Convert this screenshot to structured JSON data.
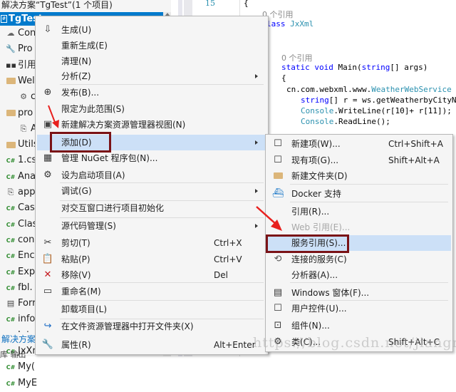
{
  "solution_explorer": {
    "title": "解决方案“TgTest”(1 个项目)",
    "root_project": "TgTest",
    "items": [
      {
        "icon": "cloud-icon",
        "label": "Con"
      },
      {
        "icon": "wrench-icon",
        "label": "Pro"
      },
      {
        "icon": "references-icon",
        "label": "引用"
      },
      {
        "icon": "folder-icon",
        "label": "Wel"
      },
      {
        "icon": "web-reference-icon",
        "label": "c"
      },
      {
        "icon": "folder-icon",
        "label": "pro"
      },
      {
        "icon": "config-file-icon",
        "label": "A"
      },
      {
        "icon": "folder-icon",
        "label": "Utils"
      },
      {
        "icon": "csharp-icon",
        "label": "1.cs"
      },
      {
        "icon": "csharp-icon",
        "label": "Ana"
      },
      {
        "icon": "config-file-icon",
        "label": "app"
      },
      {
        "icon": "csharp-icon",
        "label": "Cas"
      },
      {
        "icon": "csharp-icon",
        "label": "Clas"
      },
      {
        "icon": "csharp-icon",
        "label": "con"
      },
      {
        "icon": "csharp-icon",
        "label": "Enc"
      },
      {
        "icon": "csharp-icon",
        "label": "Exp"
      },
      {
        "icon": "csharp-icon",
        "label": "fbl."
      },
      {
        "icon": "form-icon",
        "label": "Forr"
      },
      {
        "icon": "csharp-icon",
        "label": "info"
      },
      {
        "icon": "csharp-icon",
        "label": "Inte"
      },
      {
        "icon": "csharp-icon",
        "label": "JxXr"
      },
      {
        "icon": "csharp-icon",
        "label": "My("
      },
      {
        "icon": "csharp-icon",
        "label": "MyE"
      }
    ],
    "footer_tab": "解决方案",
    "footer_tab2": "库 输出"
  },
  "editor": {
    "line_number": "15",
    "lines": {
      "brace_open": "{",
      "ref_count_1": "0 个引用",
      "class_decl_kw": "lass",
      "class_decl_name": " JxXml",
      "ref_count_2": "0 个引用",
      "main_kw1": "static",
      "main_kw2": "void",
      "main_name": " Main(",
      "main_kw3": "string",
      "main_rest": "[] args)",
      "brace_open2": "{",
      "ns_prefix": "cn.com.webxml.www.",
      "ns_type": "WeatherWebService",
      "line_a_kw": "string",
      "line_a_rest": "[] r = ws.getWeatherbyCityN",
      "line_b_type": "Console",
      "line_b_rest": ".WriteLine(r[10]+ r[11]);",
      "line_c_type": "Console",
      "line_c_rest": ".ReadLine();"
    }
  },
  "context_menu": {
    "items": [
      {
        "icon": "build-icon",
        "label": "生成(U)"
      },
      {
        "label": "重新生成(E)"
      },
      {
        "label": "清理(N)"
      },
      {
        "label": "分析(Z)",
        "submenu": true
      },
      {
        "icon": "publish-icon",
        "label": "发布(B)..."
      },
      {
        "label": "限定为此范围(S)"
      },
      {
        "icon": "new-view-icon",
        "label": "新建解决方案资源管理器视图(N)"
      },
      {
        "label": "添加(D)",
        "submenu": true,
        "highlighted": true
      },
      {
        "icon": "nuget-icon",
        "label": "管理 NuGet 程序包(N)..."
      },
      {
        "icon": "gear-icon",
        "label": "设为启动项目(A)"
      },
      {
        "label": "调试(G)",
        "submenu": true
      },
      {
        "label": "对交互窗口进行项目初始化"
      },
      {
        "label": "源代码管理(S)",
        "submenu": true
      },
      {
        "icon": "cut-icon",
        "label": "剪切(T)",
        "shortcut": "Ctrl+X"
      },
      {
        "icon": "paste-icon",
        "label": "粘贴(P)",
        "shortcut": "Ctrl+V"
      },
      {
        "icon": "remove-icon",
        "label": "移除(V)",
        "shortcut": "Del"
      },
      {
        "icon": "rename-icon",
        "label": "重命名(M)"
      },
      {
        "label": "卸载项目(L)"
      },
      {
        "icon": "open-folder-icon",
        "label": "在文件资源管理器中打开文件夹(X)"
      },
      {
        "icon": "wrench-icon",
        "label": "属性(R)",
        "shortcut": "Alt+Enter"
      }
    ]
  },
  "add_submenu": {
    "items": [
      {
        "icon": "new-item-icon",
        "label": "新建项(W)...",
        "shortcut": "Ctrl+Shift+A"
      },
      {
        "icon": "existing-item-icon",
        "label": "现有项(G)...",
        "shortcut": "Shift+Alt+A"
      },
      {
        "icon": "new-folder-icon",
        "label": "新建文件夹(D)"
      },
      {
        "icon": "docker-icon",
        "label": "Docker 支持"
      },
      {
        "label": "引用(R)..."
      },
      {
        "label": "Web 引用(E)...",
        "disabled": true
      },
      {
        "label": "服务引用(S)...",
        "highlighted": true
      },
      {
        "icon": "connected-service-icon",
        "label": "连接的服务(C)"
      },
      {
        "label": "分析器(A)..."
      },
      {
        "icon": "windows-form-icon",
        "label": "Windows 窗体(F)..."
      },
      {
        "icon": "user-control-icon",
        "label": "用户控件(U)..."
      },
      {
        "icon": "component-icon",
        "label": "组件(N)..."
      },
      {
        "icon": "class-icon",
        "label": "类(C)...",
        "shortcut": "Shift+Alt+C"
      }
    ]
  },
  "watermark": "https://blog.csdn.net/jiangnZ",
  "colors": {
    "selection": "#007acc",
    "menu_highlight": "#cce0f7",
    "annotation_box": "#7a1216",
    "annotation_arrow": "#e8201e"
  }
}
